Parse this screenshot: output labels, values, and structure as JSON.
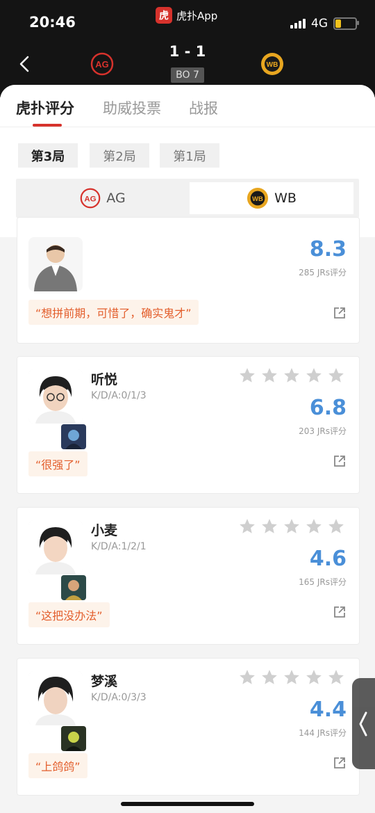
{
  "status_bar": {
    "time": "20:46",
    "app_name": "虎扑App",
    "app_logo_char": "虎",
    "network": "4G"
  },
  "match": {
    "score": "1 - 1",
    "format": "BO 7",
    "team_left_logo": "AG",
    "team_right_logo": "WB"
  },
  "tabs": [
    {
      "label": "虎扑评分",
      "active": true
    },
    {
      "label": "助威投票",
      "active": false
    },
    {
      "label": "战报",
      "active": false
    }
  ],
  "games": [
    {
      "label": "第3局",
      "active": true
    },
    {
      "label": "第2局",
      "active": false
    },
    {
      "label": "第1局",
      "active": false
    }
  ],
  "team_switch": [
    {
      "label": "AG",
      "selected": false
    },
    {
      "label": "WB",
      "selected": true
    }
  ],
  "players": [
    {
      "name": "",
      "kda": "",
      "score": "8.3",
      "count": "285 JRs评分",
      "quote": "“想拼前期，可惜了，确实鬼才”"
    },
    {
      "name": "听悦",
      "kda": "K/D/A:0/1/3",
      "score": "6.8",
      "count": "203 JRs评分",
      "quote": "“很强了”"
    },
    {
      "name": "小麦",
      "kda": "K/D/A:1/2/1",
      "score": "4.6",
      "count": "165 JRs评分",
      "quote": "“这把没办法”"
    },
    {
      "name": "梦溪",
      "kda": "K/D/A:0/3/3",
      "score": "4.4",
      "count": "144 JRs评分",
      "quote": "“上鸽鸽”"
    }
  ],
  "colors": {
    "accent_red": "#d6322c",
    "score_blue": "#4a8fd8",
    "quote_orange": "#e35e2c",
    "wb_gold": "#e8a620"
  },
  "icons": {
    "back": "chevron-left-icon",
    "share": "share-icon",
    "star": "star-icon",
    "side_handle": "chevron-left-icon"
  }
}
